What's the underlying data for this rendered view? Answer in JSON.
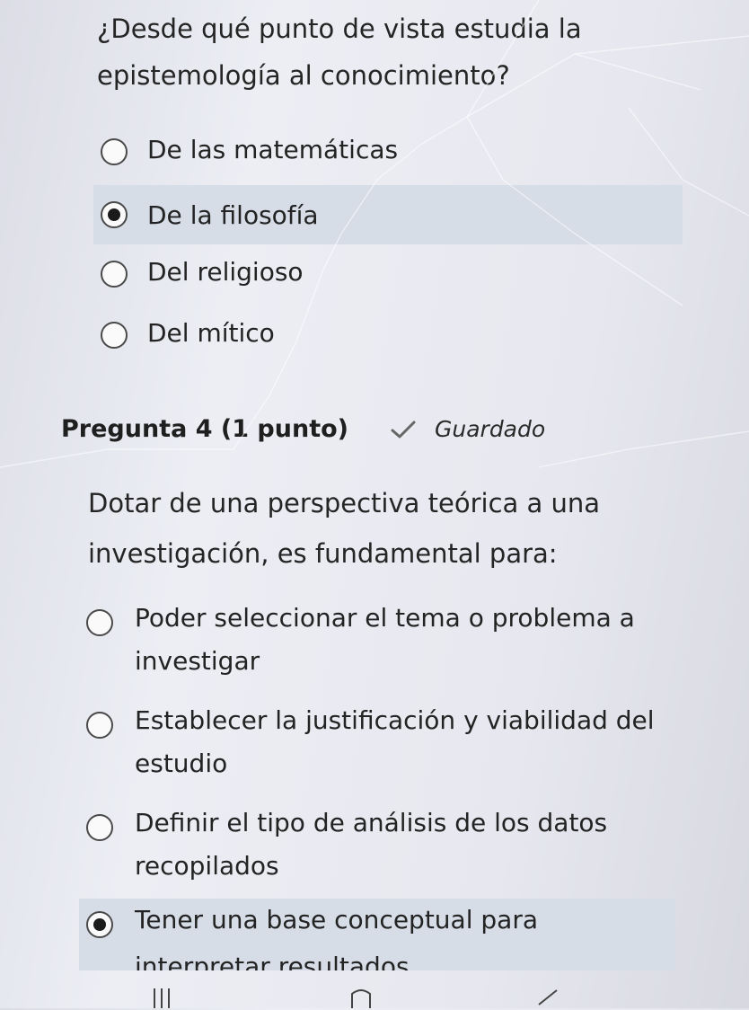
{
  "question3": {
    "text": "¿Desde qué punto de vista estudia la epistemología al conocimiento?",
    "options": [
      {
        "label": "De las matemáticas",
        "selected": false
      },
      {
        "label": "De la filosofía",
        "selected": true
      },
      {
        "label": "Del religioso",
        "selected": false
      },
      {
        "label": "Del mítico",
        "selected": false
      }
    ]
  },
  "question4": {
    "header": "Pregunta 4 (1 punto)",
    "status": "Guardado",
    "text": "Dotar de una perspectiva teórica a una investigación, es fundamental para:",
    "options": [
      {
        "label": "Poder seleccionar el tema o problema a investigar",
        "selected": false
      },
      {
        "label": "Establecer la justificación y viabilidad del estudio",
        "selected": false
      },
      {
        "label": "Definir el tipo de análisis de los datos recopilados",
        "selected": false
      },
      {
        "label": "Tener una base conceptual para interpretar resultados",
        "selected": true
      }
    ]
  },
  "colors": {
    "selected_bg": "#d6dde7",
    "text": "#232323"
  },
  "icons": {
    "status": "check-icon"
  }
}
